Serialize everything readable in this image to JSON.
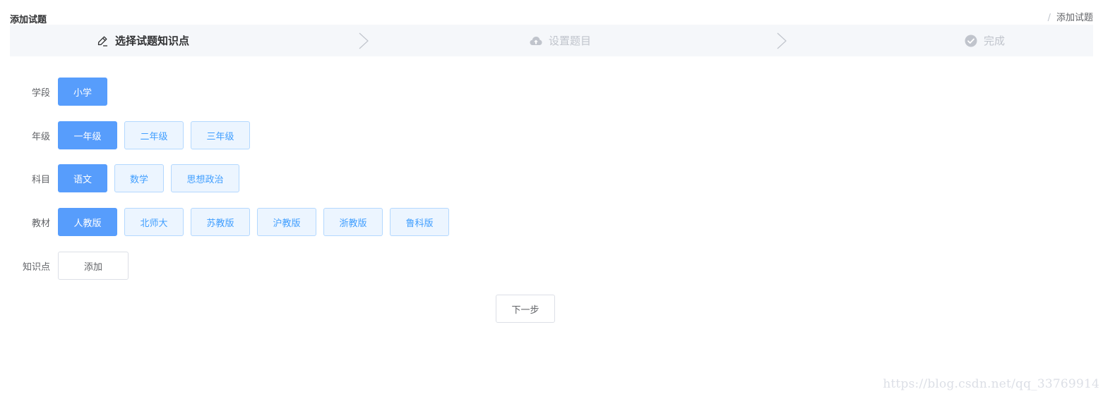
{
  "header": {
    "title": "添加试题",
    "breadcrumb_separator": "/",
    "breadcrumb_current": "添加试题"
  },
  "steps": [
    {
      "label": "选择试题知识点",
      "icon": "edit-icon",
      "active": true
    },
    {
      "label": "设置题目",
      "icon": "cloud-upload-icon",
      "active": false
    },
    {
      "label": "完成",
      "icon": "check-circle-icon",
      "active": false
    }
  ],
  "form": {
    "stage": {
      "label": "学段",
      "options": [
        "小学"
      ],
      "selected": "小学"
    },
    "grade": {
      "label": "年级",
      "options": [
        "一年级",
        "二年级",
        "三年级"
      ],
      "selected": "一年级"
    },
    "subject": {
      "label": "科目",
      "options": [
        "语文",
        "数学",
        "思想政治"
      ],
      "selected": "语文"
    },
    "textbook": {
      "label": "教材",
      "options": [
        "人教版",
        "北师大",
        "苏教版",
        "沪教版",
        "浙教版",
        "鲁科版"
      ],
      "selected": "人教版"
    },
    "knowledge": {
      "label": "知识点",
      "add_label": "添加"
    }
  },
  "next_label": "下一步",
  "watermark": "https://blog.csdn.net/qq_33769914",
  "colors": {
    "primary": "#409eff",
    "selected_bg": "#579dfc",
    "option_bg": "#ecf5ff",
    "option_border": "#b3d8ff"
  }
}
